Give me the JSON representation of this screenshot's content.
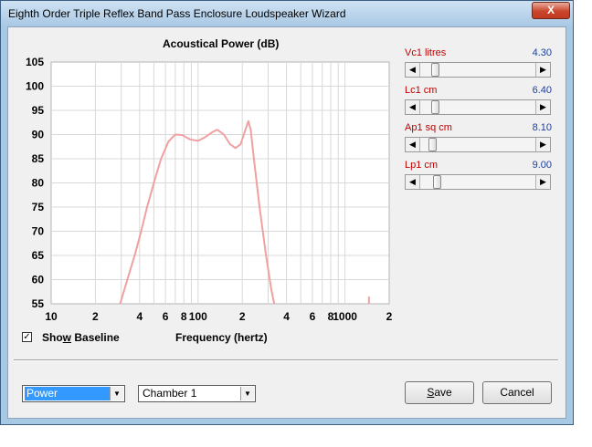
{
  "window": {
    "title": "Eighth Order Triple Reflex Band Pass Enclosure Loudspeaker Wizard",
    "close_glyph": "X"
  },
  "chart_data": {
    "type": "line",
    "title": "Acoustical Power (dB)",
    "xlabel": "Frequency (hertz)",
    "ylabel": "",
    "xscale": "log",
    "xlim": [
      10,
      2000
    ],
    "ylim": [
      55,
      105
    ],
    "y_ticks": [
      55,
      60,
      65,
      70,
      75,
      80,
      85,
      90,
      95,
      100,
      105
    ],
    "x_tick_labels": [
      {
        "x": 10,
        "label": "10"
      },
      {
        "x": 20,
        "label": "2"
      },
      {
        "x": 40,
        "label": "4"
      },
      {
        "x": 60,
        "label": "6"
      },
      {
        "x": 80,
        "label": "8"
      },
      {
        "x": 100,
        "label": "100"
      },
      {
        "x": 200,
        "label": "2"
      },
      {
        "x": 400,
        "label": "4"
      },
      {
        "x": 600,
        "label": "6"
      },
      {
        "x": 800,
        "label": "8"
      },
      {
        "x": 1000,
        "label": "1000"
      },
      {
        "x": 2000,
        "label": "2"
      }
    ],
    "grid": true,
    "series": [
      {
        "color": "#f0a0a0",
        "points": [
          [
            29.5,
            55
          ],
          [
            33,
            60
          ],
          [
            37,
            65
          ],
          [
            41,
            70
          ],
          [
            45,
            75
          ],
          [
            50,
            80
          ],
          [
            56,
            85
          ],
          [
            63,
            88.6
          ],
          [
            70,
            90
          ],
          [
            78,
            89.9
          ],
          [
            88,
            89
          ],
          [
            100,
            88.7
          ],
          [
            112,
            89.5
          ],
          [
            125,
            90.5
          ],
          [
            135,
            91
          ],
          [
            150,
            90
          ],
          [
            165,
            88
          ],
          [
            180,
            87.2
          ],
          [
            195,
            88
          ],
          [
            210,
            91
          ],
          [
            220,
            92.8
          ],
          [
            228,
            91
          ],
          [
            240,
            85
          ],
          [
            262,
            75
          ],
          [
            290,
            65
          ],
          [
            315,
            58
          ],
          [
            330,
            55
          ]
        ]
      },
      {
        "color": "#f0a0a0",
        "points": [
          [
            1455,
            55
          ],
          [
            1455,
            56.5
          ]
        ]
      }
    ]
  },
  "sliders": [
    {
      "label": "Vc1  litres",
      "value": "4.30",
      "position": 0.1
    },
    {
      "label": "Lc1  cm",
      "value": "6.40",
      "position": 0.1
    },
    {
      "label": "Ap1  sq cm",
      "value": "8.10",
      "position": 0.08
    },
    {
      "label": "Lp1  cm",
      "value": "9.00",
      "position": 0.12
    }
  ],
  "baseline": {
    "checked_glyph": "✓",
    "label_pre": "Sho",
    "label_accel": "w",
    "label_post": " Baseline"
  },
  "dropdowns": {
    "type": {
      "value": "Power"
    },
    "chamber": {
      "value": "Chamber 1"
    }
  },
  "buttons": {
    "save_accel": "S",
    "save_rest": "ave",
    "cancel": "Cancel"
  },
  "colors": {
    "curve": "#f0a0a0",
    "slider_label": "#c00000",
    "slider_value": "#1c3f99",
    "selection": "#3399ff"
  }
}
